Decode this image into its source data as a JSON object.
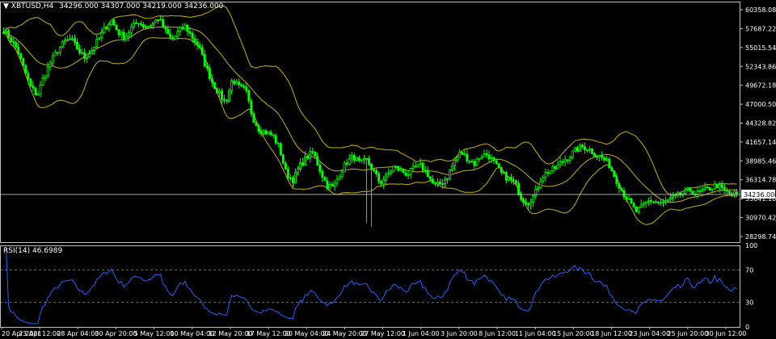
{
  "header": {
    "symbol_timeframe": "XBTUSD,H4",
    "ohlc": "34296.000 34307.000 34219.000 34236.000"
  },
  "rsi_header": "RSI(14) 46.6989",
  "colors": {
    "background": "#000000",
    "candle": "#00ff00",
    "bollinger": "#c8b400",
    "rsi_line": "#1e64ff",
    "grid": "#808080",
    "price_line": "#c0c0c0"
  },
  "chart_data": [
    {
      "type": "candlestick",
      "indicator": "Bollinger Bands",
      "title": "",
      "ylim": [
        27500,
        61500
      ],
      "yticks": [
        "60358.080",
        "57687.220",
        "55015.540",
        "52343.860",
        "49672.180",
        "47000.500",
        "44328.820",
        "41657.140",
        "38985.460",
        "36314.780",
        "33641.100",
        "30970.420",
        "28298.740"
      ],
      "current_price_label": "34236.000",
      "current_price": 34236,
      "xticks": [
        "20 Apr 2021",
        "23 Apr 12:00",
        "28 Apr 04:00",
        "30 Apr 20:00",
        "5 May 12:00",
        "10 May 04:00",
        "12 May 20:00",
        "17 May 12:00",
        "20 May 04:00",
        "24 May 20:00",
        "27 May 12:00",
        "1 Jun 04:00",
        "3 Jun 20:00",
        "8 Jun 12:00",
        "11 Jun 04:00",
        "15 Jun 20:00",
        "18 Jun 12:00",
        "23 Jun 04:00",
        "25 Jun 20:00",
        "30 Jun 12:00"
      ],
      "close_series": [
        57500,
        56200,
        54800,
        52000,
        49500,
        48200,
        51000,
        53000,
        54600,
        55800,
        56200,
        54800,
        53600,
        54500,
        56000,
        57600,
        58900,
        57200,
        56400,
        57800,
        58700,
        57900,
        58300,
        59200,
        57400,
        56000,
        57300,
        58000,
        56500,
        55200,
        52400,
        50100,
        48500,
        47200,
        50500,
        49400,
        48900,
        45200,
        43400,
        43000,
        42600,
        40800,
        37200,
        36300,
        38200,
        39500,
        40200,
        37800,
        35600,
        35200,
        37300,
        38800,
        39600,
        38600,
        39100,
        37500,
        35800,
        36900,
        38200,
        37600,
        37100,
        37900,
        38300,
        37200,
        35400,
        35800,
        36800,
        38900,
        40200,
        39300,
        38600,
        39800,
        39900,
        38600,
        37200,
        36500,
        35900,
        33700,
        33100,
        34300,
        36800,
        37500,
        37900,
        38900,
        39600,
        40500,
        41000,
        40700,
        39900,
        39400,
        38500,
        36500,
        34600,
        33200,
        31800,
        32600,
        33400,
        33200,
        32900,
        33600,
        33900,
        34400,
        34900,
        34300,
        34800,
        35100,
        35600,
        34800,
        34300,
        34236
      ]
    },
    {
      "type": "line",
      "indicator": "RSI",
      "period": 14,
      "last_value": 46.6989,
      "ylim": [
        0,
        100
      ],
      "yticks": [
        "100",
        "70",
        "30",
        "0"
      ],
      "levels": [
        70,
        30
      ]
    }
  ]
}
